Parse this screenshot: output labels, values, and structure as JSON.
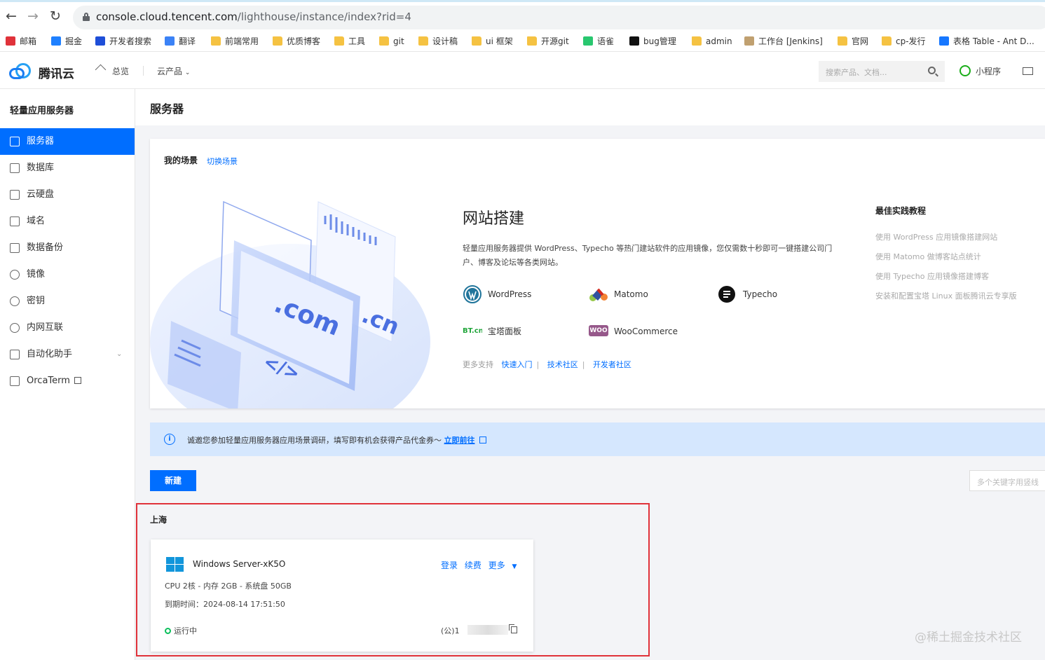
{
  "browser": {
    "url_host": "console.cloud.tencent.com",
    "url_path": "/lighthouse/instance/index?rid=4",
    "bookmarks": [
      {
        "label": "邮箱",
        "icon": "netease-icon",
        "color": "#e0323a"
      },
      {
        "label": "掘金",
        "icon": "juejin-icon",
        "color": "#1e80ff"
      },
      {
        "label": "开发者搜索",
        "icon": "dev-search-icon",
        "color": "#1e4ed8"
      },
      {
        "label": "翻译",
        "icon": "translate-icon",
        "color": "#3b82f6"
      },
      {
        "label": "前端常用",
        "icon": "folder-icon",
        "color": "#f5c242"
      },
      {
        "label": "优质博客",
        "icon": "folder-icon",
        "color": "#f5c242"
      },
      {
        "label": "工具",
        "icon": "folder-icon",
        "color": "#f5c242"
      },
      {
        "label": "git",
        "icon": "folder-icon",
        "color": "#f5c242"
      },
      {
        "label": "设计稿",
        "icon": "folder-icon",
        "color": "#f5c242"
      },
      {
        "label": "ui 框架",
        "icon": "folder-icon",
        "color": "#f5c242"
      },
      {
        "label": "开源git",
        "icon": "folder-icon",
        "color": "#f5c242"
      },
      {
        "label": "语雀",
        "icon": "yuque-icon",
        "color": "#29c76f"
      },
      {
        "label": "bug管理",
        "icon": "notion-icon",
        "color": "#111111"
      },
      {
        "label": "admin",
        "icon": "folder-icon",
        "color": "#f5c242"
      },
      {
        "label": "工作台 [Jenkins]",
        "icon": "jenkins-icon",
        "color": "#c0a070"
      },
      {
        "label": "官网",
        "icon": "folder-icon",
        "color": "#f5c242"
      },
      {
        "label": "cp-发行",
        "icon": "folder-icon",
        "color": "#f5c242"
      },
      {
        "label": "表格 Table - Ant D...",
        "icon": "antd-icon",
        "color": "#1677ff"
      }
    ]
  },
  "header": {
    "brand": "腾讯云",
    "nav_overview": "总览",
    "nav_products": "云产品",
    "search_placeholder": "搜索产品、文档...",
    "mini_program": "小程序"
  },
  "sidebar": {
    "title": "轻量应用服务器",
    "items": [
      {
        "label": "服务器",
        "icon": "server-icon",
        "active": true
      },
      {
        "label": "数据库",
        "icon": "database-icon"
      },
      {
        "label": "云硬盘",
        "icon": "disk-icon"
      },
      {
        "label": "域名",
        "icon": "domain-icon"
      },
      {
        "label": "数据备份",
        "icon": "backup-icon"
      },
      {
        "label": "镜像",
        "icon": "image-icon"
      },
      {
        "label": "密钥",
        "icon": "key-icon"
      },
      {
        "label": "内网互联",
        "icon": "network-icon"
      },
      {
        "label": "自动化助手",
        "icon": "automation-icon"
      },
      {
        "label": "OrcaTerm",
        "icon": "terminal-icon"
      }
    ]
  },
  "main": {
    "page_title": "服务器",
    "scene": {
      "heading": "我的场景",
      "switch_label": "切换场景",
      "title": "网站搭建",
      "description": "轻量应用服务器提供 WordPress、Typecho 等热门建站软件的应用镜像，您仅需数十秒即可一键搭建公司门户、博客及论坛等各类网站。",
      "illustration_text_com": ".com",
      "illustration_text_cn": ".cn",
      "illustration_text_code": "</>",
      "apps": [
        {
          "label": "WordPress",
          "icon": "wordpress-icon"
        },
        {
          "label": "Matomo",
          "icon": "matomo-icon"
        },
        {
          "label": "Typecho",
          "icon": "typecho-icon"
        },
        {
          "label": "宝塔面板",
          "icon": "bt-panel-icon",
          "icon_text": "BT.cn"
        },
        {
          "label": "WooCommerce",
          "icon": "woocommerce-icon",
          "icon_text": "WOO"
        }
      ],
      "more_support": "更多支持",
      "links": [
        "快速入门",
        "技术社区",
        "开发者社区"
      ],
      "best_practice_title": "最佳实践教程",
      "best_practices": [
        "使用 WordPress 应用镜像搭建网站",
        "使用 Matomo 做博客站点统计",
        "使用 Typecho 应用镜像搭建博客",
        "安装和配置宝塔 Linux 面板腾讯云专享版"
      ]
    },
    "notice": {
      "text": "诚邀您参加轻量应用服务器应用场景调研，填写即有机会获得产品代金券～",
      "link": "立即前往"
    },
    "new_button": "新建",
    "filter_placeholder": "多个关键字用竖线",
    "region": {
      "name": "上海",
      "instance": {
        "name": "Windows Server-xK5O",
        "actions": [
          "登录",
          "续费",
          "更多"
        ],
        "spec": "CPU 2核 - 内存 2GB - 系统盘 50GB",
        "expiry_label": "到期时间：",
        "expiry": "2024-08-14 17:51:50",
        "status": "运行中",
        "ip_prefix": "(公)1"
      }
    }
  },
  "watermark": "@稀土掘金技术社区",
  "colors": {
    "accent": "#006eff",
    "highlight_border": "#e0323a",
    "running": "#0abf5b"
  }
}
